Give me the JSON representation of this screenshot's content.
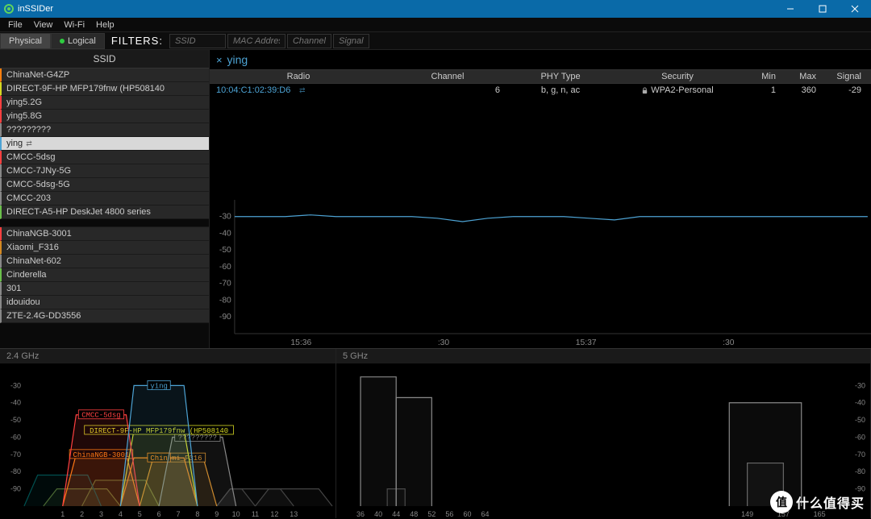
{
  "window": {
    "title": "inSSIDer"
  },
  "menu": {
    "file": "File",
    "view": "View",
    "wifi": "Wi-Fi",
    "help": "Help"
  },
  "toolbar": {
    "physical": "Physical",
    "logical": "Logical",
    "filters_label": "FILTERS:",
    "ssid_ph": "SSID",
    "mac_ph": "MAC Address",
    "channel_ph": "Channel",
    "signal_ph": "Signal"
  },
  "sidebar": {
    "header": "SSID",
    "items": [
      {
        "name": "ChinaNet-G4ZP",
        "color": "#ff7f0e",
        "selected": false
      },
      {
        "name": "DIRECT-9F-HP MFP179fnw (HP508140",
        "color": "#d6d822",
        "selected": false
      },
      {
        "name": "ying5.2G",
        "color": "#ff4040",
        "selected": false
      },
      {
        "name": "ying5.8G",
        "color": "#ff4040",
        "selected": false
      },
      {
        "name": "?????????",
        "color": "#888",
        "selected": false
      },
      {
        "name": "ying",
        "color": "#4da3d4",
        "selected": true,
        "link": true
      },
      {
        "name": "CMCC-5dsg",
        "color": "#ff4040",
        "selected": false
      },
      {
        "name": "CMCC-7JNy-5G",
        "color": "#888",
        "selected": false
      },
      {
        "name": "CMCC-5dsg-5G",
        "color": "#888",
        "selected": false
      },
      {
        "name": "CMCC-203",
        "color": "#888",
        "selected": false
      },
      {
        "name": "DIRECT-A5-HP DeskJet 4800 series",
        "color": "#6bbf4b",
        "selected": false
      }
    ],
    "items2": [
      {
        "name": "ChinaNGB-3001",
        "color": "#ff4040"
      },
      {
        "name": "Xiaomi_F316",
        "color": "#d68a22"
      },
      {
        "name": "ChinaNet-602",
        "color": "#888"
      },
      {
        "name": "Cinderella",
        "color": "#6bbf4b"
      },
      {
        "name": "301",
        "color": "#888"
      },
      {
        "name": "idouidou",
        "color": "#888"
      },
      {
        "name": "ZTE-2.4G-DD3556",
        "color": "#888"
      }
    ]
  },
  "detail": {
    "selected_name": "ying",
    "columns": {
      "radio": "Radio",
      "channel": "Channel",
      "phy": "PHY Type",
      "security": "Security",
      "min": "Min",
      "max": "Max",
      "signal": "Signal"
    },
    "row": {
      "radio": "10:04:C1:02:39:D6",
      "channel": "6",
      "phy": "b, g, n, ac",
      "security": "WPA2-Personal",
      "min": "1",
      "max": "360",
      "signal": "-29"
    }
  },
  "chart_data": {
    "signal_timeline": {
      "type": "line",
      "ylim": [
        -100,
        -20
      ],
      "yticks": [
        -30,
        -40,
        -50,
        -60,
        -70,
        -80,
        -90
      ],
      "xticks": [
        "15:36",
        ":30",
        "15:37",
        ":30"
      ],
      "series": [
        {
          "name": "ying",
          "color": "#4da3d4",
          "values": [
            -30,
            -30,
            -30,
            -29,
            -30,
            -30,
            -30,
            -30,
            -31,
            -33,
            -31,
            -30,
            -30,
            -30,
            -31,
            -32,
            -30,
            -30,
            -30,
            -30,
            -30,
            -30,
            -30,
            -30,
            -30,
            -30
          ]
        }
      ]
    },
    "spectrum_24": {
      "type": "area-range",
      "title": "2.4 GHz",
      "xlabel_channels": [
        1,
        2,
        3,
        4,
        5,
        6,
        7,
        8,
        9,
        10,
        11,
        12,
        13
      ],
      "yticks": [
        -30,
        -40,
        -50,
        -60,
        -70,
        -80,
        -90
      ],
      "networks": [
        {
          "name": "ying",
          "center": 6,
          "width": 4,
          "peak": -30,
          "color": "#4da3d4",
          "label": true
        },
        {
          "name": "CMCC-5dsg",
          "center": 3,
          "width": 4,
          "peak": -47,
          "color": "#ff4040",
          "label": true
        },
        {
          "name": "DIRECT-9F-HP MFP179fnw (HP508140",
          "center": 6,
          "width": 4,
          "peak": -56,
          "color": "#d6d822",
          "label": true
        },
        {
          "name": "?????????",
          "center": 8,
          "width": 4,
          "peak": -60,
          "color": "#888",
          "label": true
        },
        {
          "name": "ChinaNGB-3001",
          "center": 3,
          "width": 4,
          "peak": -70,
          "color": "#ff7f0e",
          "label": true
        },
        {
          "name": "Xiaomi_F316",
          "center": 7,
          "width": 4,
          "peak": -72,
          "color": "#d68a22",
          "label": true
        },
        {
          "name": "Chin",
          "center": 6,
          "width": 4,
          "peak": -72,
          "color": "#ff7f0e",
          "label": true
        },
        {
          "name": "",
          "center": 1,
          "width": 4,
          "peak": -82,
          "color": "#005050"
        },
        {
          "name": "",
          "center": 2,
          "width": 4,
          "peak": -90,
          "color": "#556b2f"
        },
        {
          "name": "",
          "center": 4,
          "width": 4,
          "peak": -85,
          "color": "#556b2f"
        },
        {
          "name": "",
          "center": 10,
          "width": 2,
          "peak": -90,
          "color": "#444"
        },
        {
          "name": "",
          "center": 11,
          "width": 4,
          "peak": -90,
          "color": "#444"
        },
        {
          "name": "",
          "center": 13,
          "width": 4,
          "peak": -90,
          "color": "#444"
        }
      ]
    },
    "spectrum_5": {
      "type": "area-range",
      "title": "5 GHz",
      "xlabel_channels": [
        36,
        40,
        44,
        48,
        52,
        56,
        60,
        64,
        149,
        157,
        165
      ],
      "yticks": [
        -30,
        -40,
        -50,
        -60,
        -70,
        -80,
        -90
      ],
      "networks": [
        {
          "center": 40,
          "width": 8,
          "peak": -25,
          "color": "#888"
        },
        {
          "center": 48,
          "width": 8,
          "peak": -37,
          "color": "#888"
        },
        {
          "center": 44,
          "width": 4,
          "peak": -90,
          "color": "#444"
        },
        {
          "center": 153,
          "width": 16,
          "peak": -40,
          "color": "#888"
        },
        {
          "center": 153,
          "width": 8,
          "peak": -75,
          "color": "#666"
        }
      ]
    }
  },
  "watermark": "什么值得买"
}
